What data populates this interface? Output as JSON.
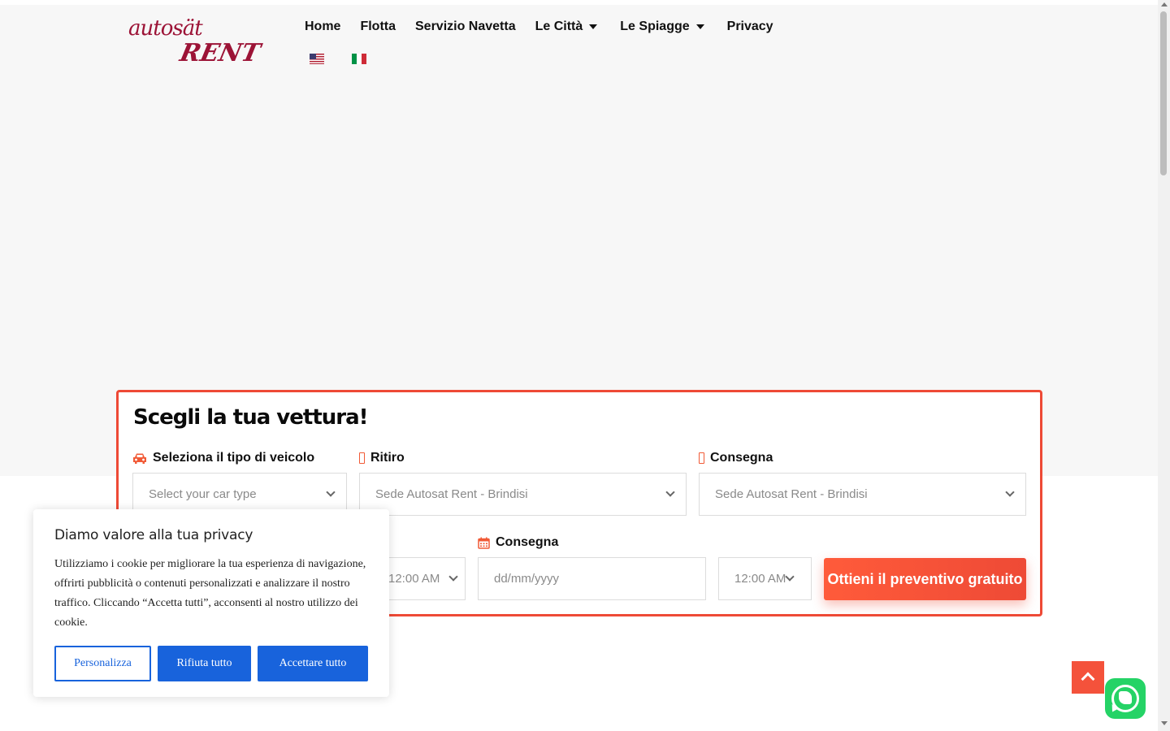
{
  "header": {
    "logo_line1": "autosät",
    "logo_line2": "RENT",
    "nav": [
      {
        "label": "Home"
      },
      {
        "label": "Flotta"
      },
      {
        "label": "Servizio Navetta"
      },
      {
        "label": "Le Città"
      },
      {
        "label": "Le Spiagge"
      },
      {
        "label": "Privacy"
      }
    ],
    "flags": [
      "flag-us-icon",
      "flag-it-icon"
    ]
  },
  "booking": {
    "title": "Scegli la tua vettura!",
    "vehicle_label": "Seleziona il tipo di veicolo",
    "vehicle_placeholder": "Select your car type",
    "pickup_label": "Ritiro",
    "pickup_value": "Sede Autosat Rent - Brindisi",
    "dropoff_label": "Consegna",
    "dropoff_value": "Sede Autosat Rent - Brindisi",
    "pickup_time_value": "12:00 AM",
    "return_date_label": "Consegna",
    "return_date_placeholder": "dd/mm/yyyy",
    "return_time_value": "12:00 AM",
    "submit_label": "Ottieni il preventivo gratuito"
  },
  "cookie": {
    "title": "Diamo valore alla tua privacy",
    "text": "Utilizziamo i cookie per migliorare la tua esperienza di navigazione, offrirti pubblicità o contenuti personalizzati e analizzare il nostro traffico. Cliccando “Accetta tutti”, acconsenti al nostro utilizzo dei cookie.",
    "customize_label": "Personalizza",
    "reject_label": "Rifiuta tutto",
    "accept_label": "Accettare tutto"
  },
  "colors": {
    "accent": "#ee4a36",
    "brand": "#9c1336",
    "cookie_blue": "#1863dc",
    "whatsapp": "#25d366"
  }
}
